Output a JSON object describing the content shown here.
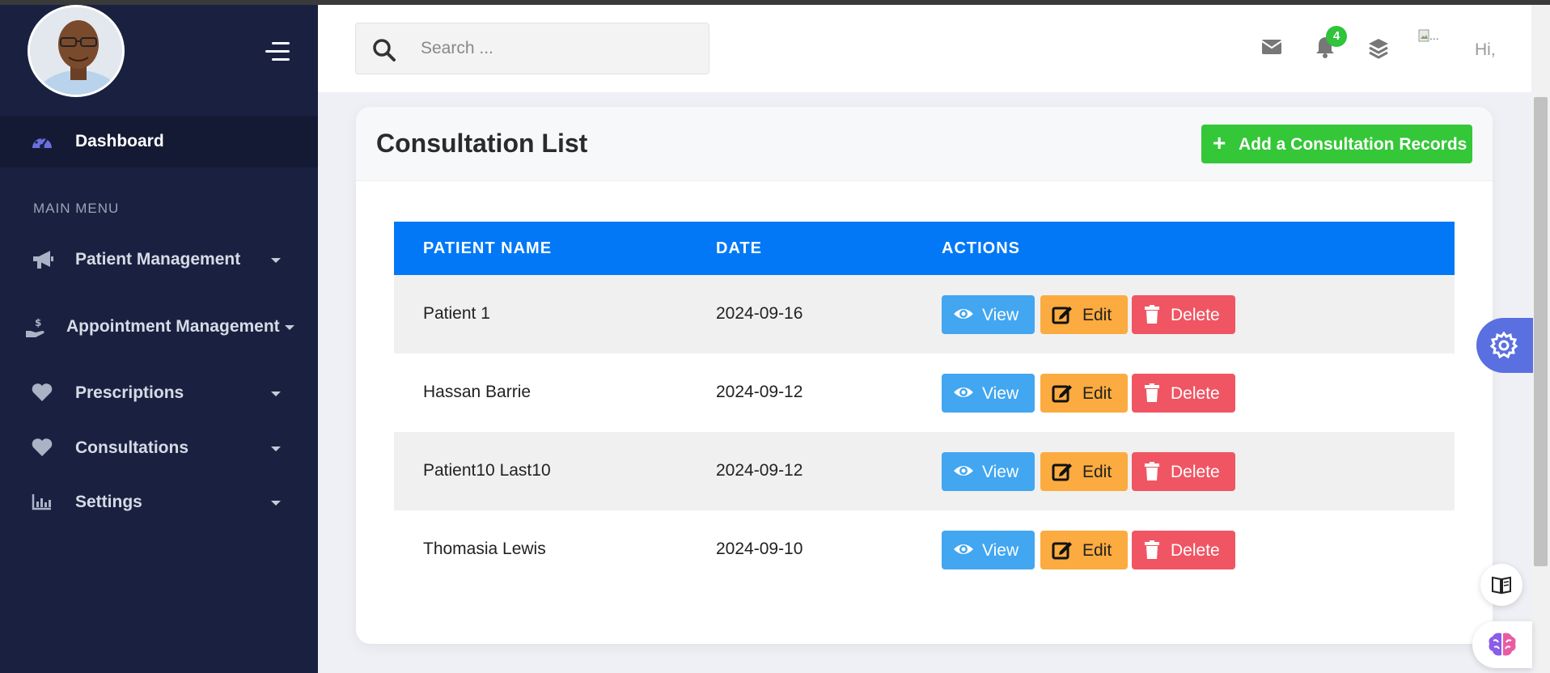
{
  "header": {
    "search_placeholder": "Search ...",
    "notification_count": "4",
    "user_image_alt": "...",
    "greeting": "Hi,"
  },
  "sidebar": {
    "dashboard_label": "Dashboard",
    "menu_header": "MAIN MENU",
    "items": [
      {
        "label": "Patient Management",
        "icon": "megaphone-icon"
      },
      {
        "label": "Appointment Management",
        "icon": "hand-holding-dollar-icon"
      },
      {
        "label": "Prescriptions",
        "icon": "heart-icon"
      },
      {
        "label": "Consultations",
        "icon": "heart-icon"
      },
      {
        "label": "Settings",
        "icon": "bar-chart-icon"
      }
    ]
  },
  "main": {
    "title": "Consultation List",
    "add_button_label": "Add a Consultation Records",
    "table": {
      "columns": [
        "PATIENT NAME",
        "DATE",
        "ACTIONS"
      ],
      "rows": [
        {
          "patient": "Patient 1",
          "date": "2024-09-16"
        },
        {
          "patient": "Hassan Barrie",
          "date": "2024-09-12"
        },
        {
          "patient": "Patient10 Last10",
          "date": "2024-09-12"
        },
        {
          "patient": "Thomasia Lewis",
          "date": "2024-09-10"
        }
      ],
      "actions": {
        "view": "View",
        "edit": "Edit",
        "delete": "Delete"
      }
    }
  },
  "colors": {
    "sidebar_bg": "#1a2140",
    "table_header": "#0278f7",
    "add_button": "#34c738",
    "view": "#42a6f0",
    "edit": "#fbab3f",
    "delete": "#f05563"
  }
}
